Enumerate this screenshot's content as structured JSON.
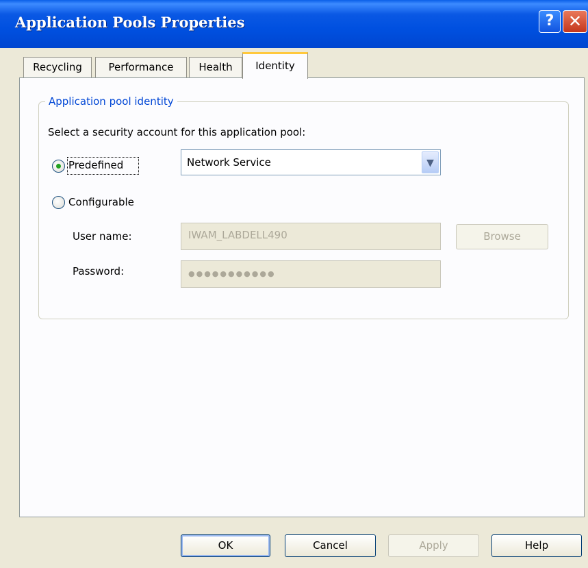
{
  "window": {
    "title": "Application Pools Properties",
    "help_glyph": "?",
    "close_glyph": "✕"
  },
  "tabs": [
    {
      "label": "Recycling",
      "selected": false
    },
    {
      "label": "Performance",
      "selected": false
    },
    {
      "label": "Health",
      "selected": false
    },
    {
      "label": "Identity",
      "selected": true
    }
  ],
  "identity": {
    "group_label": "Application pool identity",
    "prompt": "Select a security account for this application pool:",
    "predefined": {
      "label": "Predefined",
      "selected": true
    },
    "account_select": {
      "value": "Network Service"
    },
    "configurable": {
      "label": "Configurable",
      "selected": false
    },
    "user_name": {
      "label": "User name:",
      "value": "IWAM_LABDELL490"
    },
    "password": {
      "label": "Password:",
      "value": "●●●●●●●●●●●"
    },
    "browse_label": "Browse"
  },
  "buttons": {
    "ok": "OK",
    "cancel": "Cancel",
    "apply": "Apply",
    "help": "Help"
  },
  "colors": {
    "titlebar": "#0054e3",
    "legend_text": "#0046d5",
    "selected_tab_accent": "#ffc83c",
    "radio_dot": "#21a121"
  }
}
